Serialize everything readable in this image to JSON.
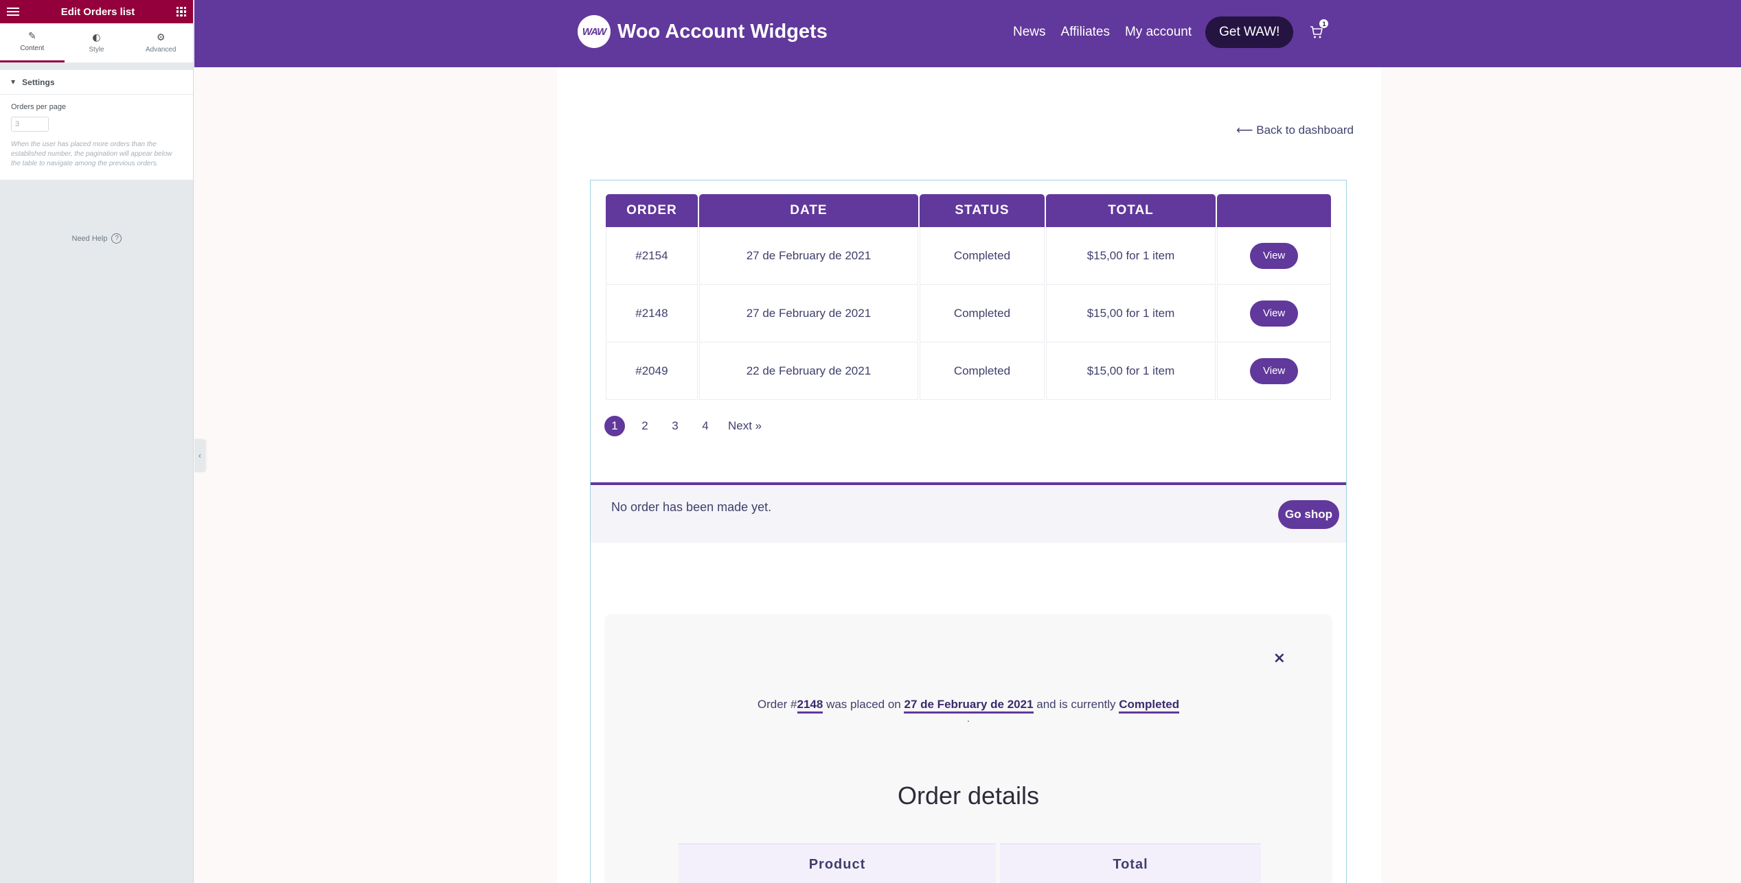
{
  "editor": {
    "title": "Edit Orders list",
    "tabs": [
      {
        "label": "Content",
        "icon": "pencil-icon"
      },
      {
        "label": "Style",
        "icon": "contrast-icon"
      },
      {
        "label": "Advanced",
        "icon": "gear-icon"
      }
    ],
    "section_title": "Settings",
    "orders_per_page_label": "Orders per page",
    "orders_per_page_value": "3",
    "orders_per_page_description": "When the user has placed more orders than the established number, the pagination will appear below the table to navigate among the previous orders.",
    "need_help": "Need Help",
    "accent_color": "#93003c"
  },
  "site": {
    "logo_text": "WAW",
    "brand_name": "Woo Account Widgets",
    "nav": [
      "News",
      "Affiliates",
      "My account"
    ],
    "cta": "Get WAW!",
    "cart_count": "1",
    "brand_color": "#61389b",
    "back_link": "⟵ Back to dashboard"
  },
  "orders": {
    "columns": [
      "ORDER",
      "DATE",
      "STATUS",
      "TOTAL",
      ""
    ],
    "rows": [
      {
        "order": "#2154",
        "date": "27 de February de 2021",
        "status": "Completed",
        "total": "$15,00 for 1 item",
        "action": "View"
      },
      {
        "order": "#2148",
        "date": "27 de February de 2021",
        "status": "Completed",
        "total": "$15,00 for 1 item",
        "action": "View"
      },
      {
        "order": "#2049",
        "date": "22 de February de 2021",
        "status": "Completed",
        "total": "$15,00 for 1 item",
        "action": "View"
      }
    ],
    "pages": [
      "1",
      "2",
      "3",
      "4"
    ],
    "current_page": "1",
    "next_label": "Next »"
  },
  "empty_notice": {
    "message": "No order has been made yet.",
    "button": "Go shop"
  },
  "order_detail": {
    "close": "×",
    "text_prefix": "Order #",
    "order_number": "2148",
    "text_placed": " was placed on ",
    "date": "27 de February de 2021",
    "text_status": " and is currently ",
    "status": "Completed",
    "dot": ".",
    "details_title": "Order details",
    "columns": [
      "Product",
      "Total"
    ]
  }
}
